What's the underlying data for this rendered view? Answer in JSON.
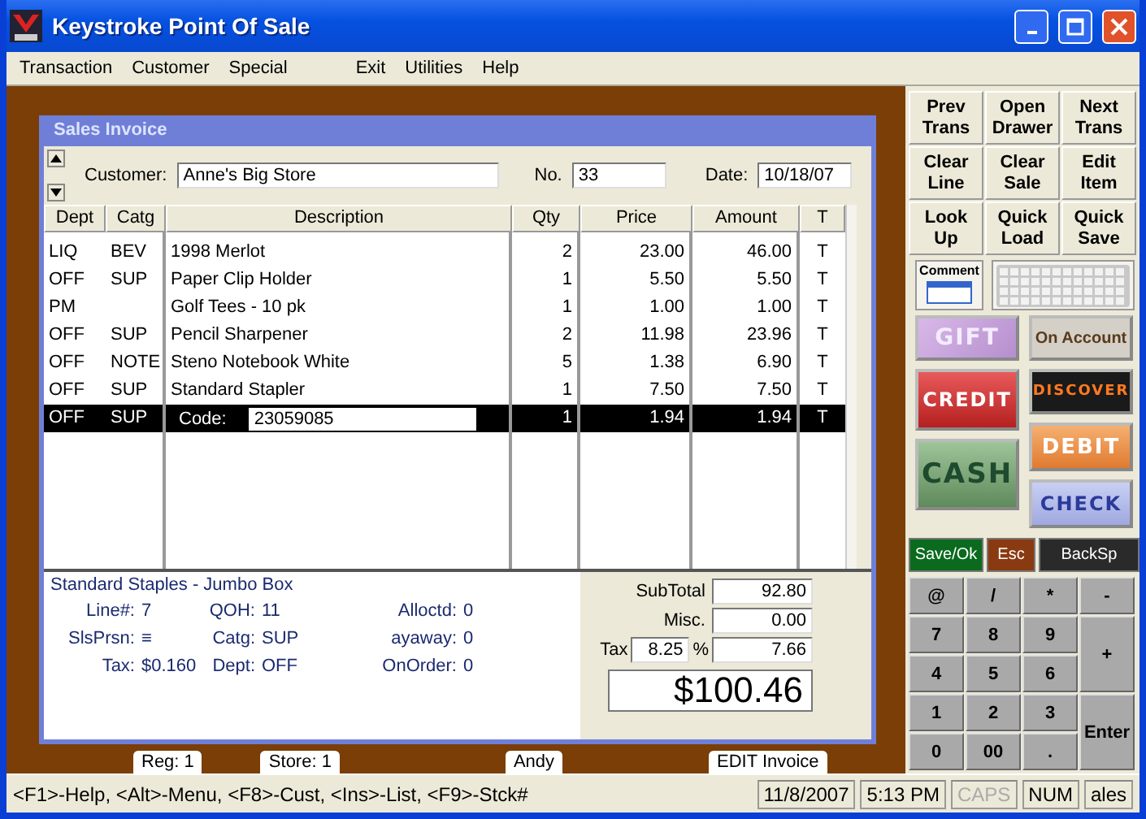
{
  "window": {
    "title": "Keystroke Point Of Sale"
  },
  "menu": [
    [
      "Transaction",
      "Customer",
      "Special"
    ],
    [
      "Exit",
      "Utilities",
      "Help"
    ]
  ],
  "invoice": {
    "title": "Sales Invoice",
    "customer_label": "Customer:",
    "customer": "Anne's Big Store",
    "no_label": "No.",
    "no": "33",
    "date_label": "Date:",
    "date": "10/18/07",
    "columns": [
      "Dept",
      "Catg",
      "Description",
      "Qty",
      "Price",
      "Amount",
      "T"
    ],
    "rows": [
      {
        "dept": "LIQ",
        "catg": "BEV",
        "description": "1998 Merlot",
        "qty": "2",
        "price": "23.00",
        "amount": "46.00",
        "t": "T",
        "selected": false
      },
      {
        "dept": "OFF",
        "catg": "SUP",
        "description": "Paper Clip Holder",
        "qty": "1",
        "price": "5.50",
        "amount": "5.50",
        "t": "T",
        "selected": false
      },
      {
        "dept": "PM",
        "catg": "",
        "description": "Golf Tees - 10 pk",
        "qty": "1",
        "price": "1.00",
        "amount": "1.00",
        "t": "T",
        "selected": false
      },
      {
        "dept": "OFF",
        "catg": "SUP",
        "description": "Pencil Sharpener",
        "qty": "2",
        "price": "11.98",
        "amount": "23.96",
        "t": "T",
        "selected": false
      },
      {
        "dept": "OFF",
        "catg": "NOTE",
        "description": "Steno Notebook White",
        "qty": "5",
        "price": "1.38",
        "amount": "6.90",
        "t": "T",
        "selected": false
      },
      {
        "dept": "OFF",
        "catg": "SUP",
        "description": "Standard Stapler",
        "qty": "1",
        "price": "7.50",
        "amount": "7.50",
        "t": "T",
        "selected": false
      },
      {
        "dept": "OFF",
        "catg": "SUP",
        "code_label": "Code:",
        "code": "23059085",
        "qty": "1",
        "price": "1.94",
        "amount": "1.94",
        "t": "T",
        "selected": true
      }
    ],
    "item_name": "Standard Staples - Jumbo Box",
    "details": [
      {
        "label": "Line#:",
        "value": "7"
      },
      {
        "label": "QOH:",
        "value": "11"
      },
      {
        "label": "Alloctd:",
        "value": "0"
      },
      {
        "label": "SlsPrsn:",
        "value": "≡"
      },
      {
        "label": "Catg:",
        "value": "SUP"
      },
      {
        "label": "ayaway:",
        "value": "0"
      },
      {
        "label": "Tax:",
        "value": "$0.160"
      },
      {
        "label": "Dept:",
        "value": "OFF"
      },
      {
        "label": "OnOrder:",
        "value": "0"
      }
    ],
    "subtotal_label": "SubTotal",
    "subtotal": "92.80",
    "misc_label": "Misc.",
    "misc": "0.00",
    "tax_label": "Tax",
    "tax_rate": "8.25",
    "percent": "%",
    "tax": "7.66",
    "total": "$100.46"
  },
  "tabs": [
    {
      "label": "Reg: 1"
    },
    {
      "label": "Store: 1"
    },
    {
      "label": "Andy"
    },
    {
      "label": "EDIT Invoice"
    }
  ],
  "actions": [
    [
      "Prev",
      "Trans"
    ],
    [
      "Open",
      "Drawer"
    ],
    [
      "Next",
      "Trans"
    ],
    [
      "Clear",
      "Line"
    ],
    [
      "Clear",
      "Sale"
    ],
    [
      "Edit",
      "Item"
    ],
    [
      "Look",
      "Up"
    ],
    [
      "Quick",
      "Load"
    ],
    [
      "Quick",
      "Save"
    ]
  ],
  "comment": "Comment",
  "payments": [
    [
      {
        "kind": "gift",
        "label": "GIFT"
      },
      {
        "kind": "credit",
        "label": "CREDIT"
      },
      {
        "kind": "cash",
        "label": "CASH"
      }
    ],
    [
      {
        "kind": "account",
        "label": "On Account"
      },
      {
        "kind": "discover",
        "label": "DISCOVER"
      },
      {
        "kind": "debit",
        "label": "DEBIT"
      },
      {
        "kind": "check",
        "label": "CHECK"
      }
    ]
  ],
  "controls": [
    {
      "kind": "save",
      "label": "Save/Ok"
    },
    {
      "kind": "esc",
      "label": "Esc"
    },
    {
      "kind": "back",
      "label": "BackSp"
    }
  ],
  "keypad": [
    {
      "label": "@",
      "kind": "key"
    },
    {
      "label": "/",
      "kind": "key"
    },
    {
      "label": "*",
      "kind": "key"
    },
    {
      "label": "-",
      "kind": "key"
    },
    {
      "label": "7",
      "kind": "key"
    },
    {
      "label": "8",
      "kind": "key"
    },
    {
      "label": "9",
      "kind": "key"
    },
    {
      "label": "+",
      "kind": "tall"
    },
    {
      "label": "4",
      "kind": "key"
    },
    {
      "label": "5",
      "kind": "key"
    },
    {
      "label": "6",
      "kind": "key"
    },
    {
      "label": "1",
      "kind": "key"
    },
    {
      "label": "2",
      "kind": "key"
    },
    {
      "label": "3",
      "kind": "key"
    },
    {
      "label": "Enter",
      "kind": "tall"
    },
    {
      "label": "0",
      "kind": "key"
    },
    {
      "label": "00",
      "kind": "key"
    },
    {
      "label": ".",
      "kind": "key"
    }
  ],
  "status_bar": {
    "hint": "<F1>-Help, <Alt>-Menu, <F8>-Cust, <Ins>-List, <F9>-Stck#",
    "date": "11/8/2007",
    "time": "5:13 PM",
    "indicators": [
      {
        "label": "CAPS",
        "disabled": true
      },
      {
        "label": "NUM",
        "disabled": false
      },
      {
        "label": "ales",
        "disabled": false
      }
    ]
  }
}
